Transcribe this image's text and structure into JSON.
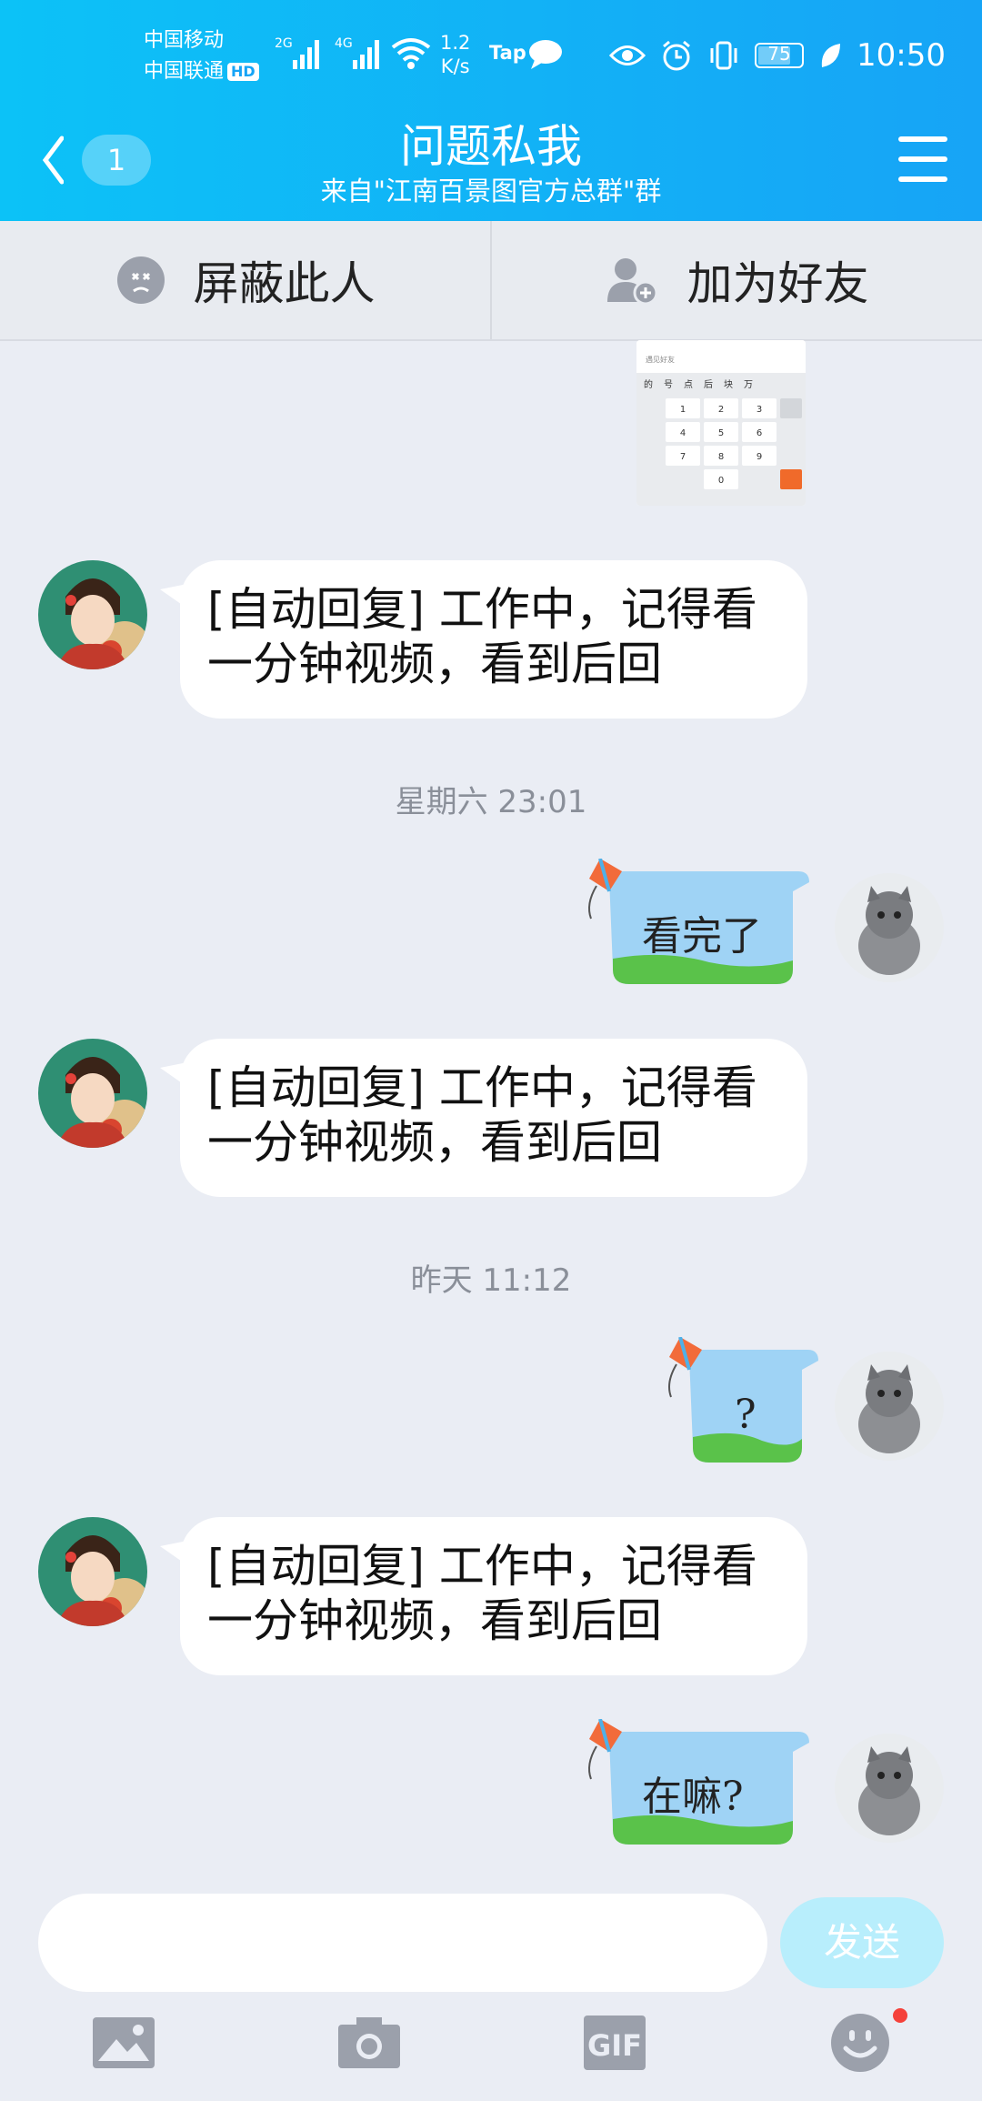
{
  "status_bar": {
    "carrier1": "中国移动",
    "carrier2": "中国联通",
    "hd": "HD",
    "net1": "2G",
    "net2": "4G",
    "speed_value": "1.2",
    "speed_unit": "K/s",
    "tap": "Tap",
    "battery": "75",
    "time": "10:50"
  },
  "header": {
    "unread_count": "1",
    "title": "问题私我",
    "subtitle": "来自\"江南百景图官方总群\"群"
  },
  "actions": {
    "block_label": "屏蔽此人",
    "add_friend_label": "加为好友"
  },
  "keyboard_thumb": {
    "field": "遇见好友",
    "row1": [
      "的",
      "号",
      "点",
      "后",
      "块",
      "万"
    ],
    "keys": [
      "1",
      "2",
      "3",
      "4",
      "5",
      "6",
      "7",
      "8",
      "9",
      "0"
    ]
  },
  "messages": [
    {
      "type": "in",
      "text_line1": "[自动回复] 工作中，记得看",
      "text_line2": "一分钟视频，看到后回"
    },
    {
      "type": "time",
      "text": "星期六 23:01"
    },
    {
      "type": "out",
      "text": "看完了"
    },
    {
      "type": "in",
      "text_line1": "[自动回复] 工作中，记得看",
      "text_line2": "一分钟视频，看到后回"
    },
    {
      "type": "time",
      "text": "昨天 11:12"
    },
    {
      "type": "out",
      "text": "?"
    },
    {
      "type": "in",
      "text_line1": "[自动回复] 工作中，记得看",
      "text_line2": "一分钟视频，看到后回"
    },
    {
      "type": "out",
      "text": "在嘛?"
    }
  ],
  "composer": {
    "input_value": "",
    "send_label": "发送"
  },
  "toolbar": {
    "gif_label": "GIF",
    "emoji_has_badge": true
  },
  "colors": {
    "header_gradient_start": "#0cc2f7",
    "header_gradient_end": "#17a4f6",
    "background": "#eaedf4",
    "send_button": "#b8eefc",
    "badge": "#f5413a"
  }
}
